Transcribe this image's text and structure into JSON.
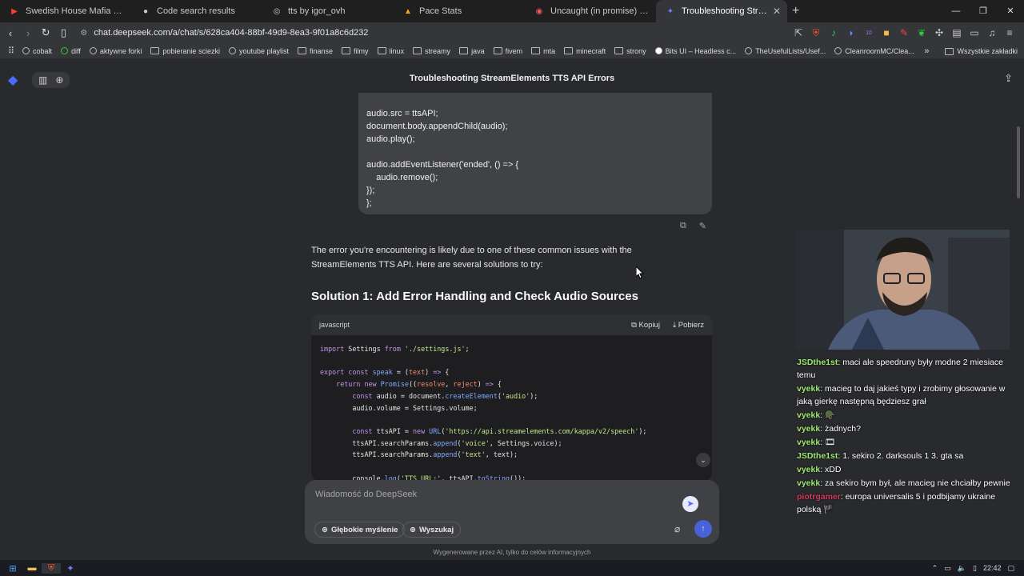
{
  "browser": {
    "tabs": [
      {
        "title": "Swedish House Mafia - Wait So S",
        "icon": "youtube-icon",
        "active": false
      },
      {
        "title": "Code search results",
        "icon": "github-icon",
        "active": false
      },
      {
        "title": "tts by igor_ovh",
        "icon": "globe-icon",
        "active": false
      },
      {
        "title": "Pace Stats",
        "icon": "pace-icon",
        "active": false
      },
      {
        "title": "Uncaught (in promise) NotSupporte",
        "icon": "shield-icon",
        "active": false
      },
      {
        "title": "Troubleshooting StreamElements",
        "icon": "deepseek-icon",
        "active": true
      }
    ],
    "url": "chat.deepseek.com/a/chat/s/628ca404-88bf-49d9-8ea3-9f01a8c6d232",
    "bookmarks": [
      "cobalt",
      "diff",
      "aktywne forki",
      "pobieranie sciezki",
      "youtube playlist",
      "finanse",
      "filmy",
      "linux",
      "streamy",
      "java",
      "fivem",
      "mta",
      "minecraft",
      "strony",
      "Bits UI – Headless c...",
      "TheUsefulLists/Usef...",
      "CleanroomMC/Clea..."
    ],
    "bookmarks_overflow": "»",
    "other_bookmarks": "Wszystkie zakładki",
    "extension_badge": "10"
  },
  "chat": {
    "title": "Troubleshooting StreamElements TTS API Errors",
    "user_code_tail": "audio.src = ttsAPI;\ndocument.body.appendChild(audio);\naudio.play();\n\naudio.addEventListener('ended', () => {\n    audio.remove();\n});\n};",
    "answer_intro": "The error you're encountering is likely due to one of these common issues with the StreamElements TTS API. Here are several solutions to try:",
    "solution_title": "Solution 1: Add Error Handling and Check Audio Sources",
    "code_lang": "javascript",
    "copy_label": "Kopiuj",
    "download_label": "Pobierz",
    "input_placeholder": "Wiadomość do DeepSeek",
    "deep_think_label": "Głębokie myślenie",
    "search_label": "Wyszukaj",
    "disclaimer": "Wygenerowane przez AI, tylko do celów informacyjnych"
  },
  "twitch_chat": [
    {
      "user": "JSDthe1st",
      "text": ": maci ale speedruny były modne 2 miesiace temu",
      "color": "green"
    },
    {
      "user": "vyekk",
      "text": ": macieg to daj jakieś typy i zrobimy głosowanie w jaką gierkę następną będziesz grał",
      "color": "green"
    },
    {
      "user": "vyekk",
      "text": ": 🪖",
      "color": "green"
    },
    {
      "user": "vyekk",
      "text": ": żadnych?",
      "color": "green"
    },
    {
      "user": "vyekk",
      "text": ": 🎞",
      "color": "green"
    },
    {
      "user": "JSDthe1st",
      "text": ": 1. sekiro 2. darksouls 1 3. gta sa",
      "color": "green"
    },
    {
      "user": "vyekk",
      "text": ": xDD",
      "color": "green"
    },
    {
      "user": "vyekk",
      "text": ": za sekiro bym był, ale macieg nie chciałby pewnie",
      "color": "green"
    },
    {
      "user": "piotrgamer",
      "text": ": europa universalis 5 i podbijamy ukraine polską 🏴",
      "color": "red"
    }
  ],
  "taskbar": {
    "time": "22:42"
  }
}
